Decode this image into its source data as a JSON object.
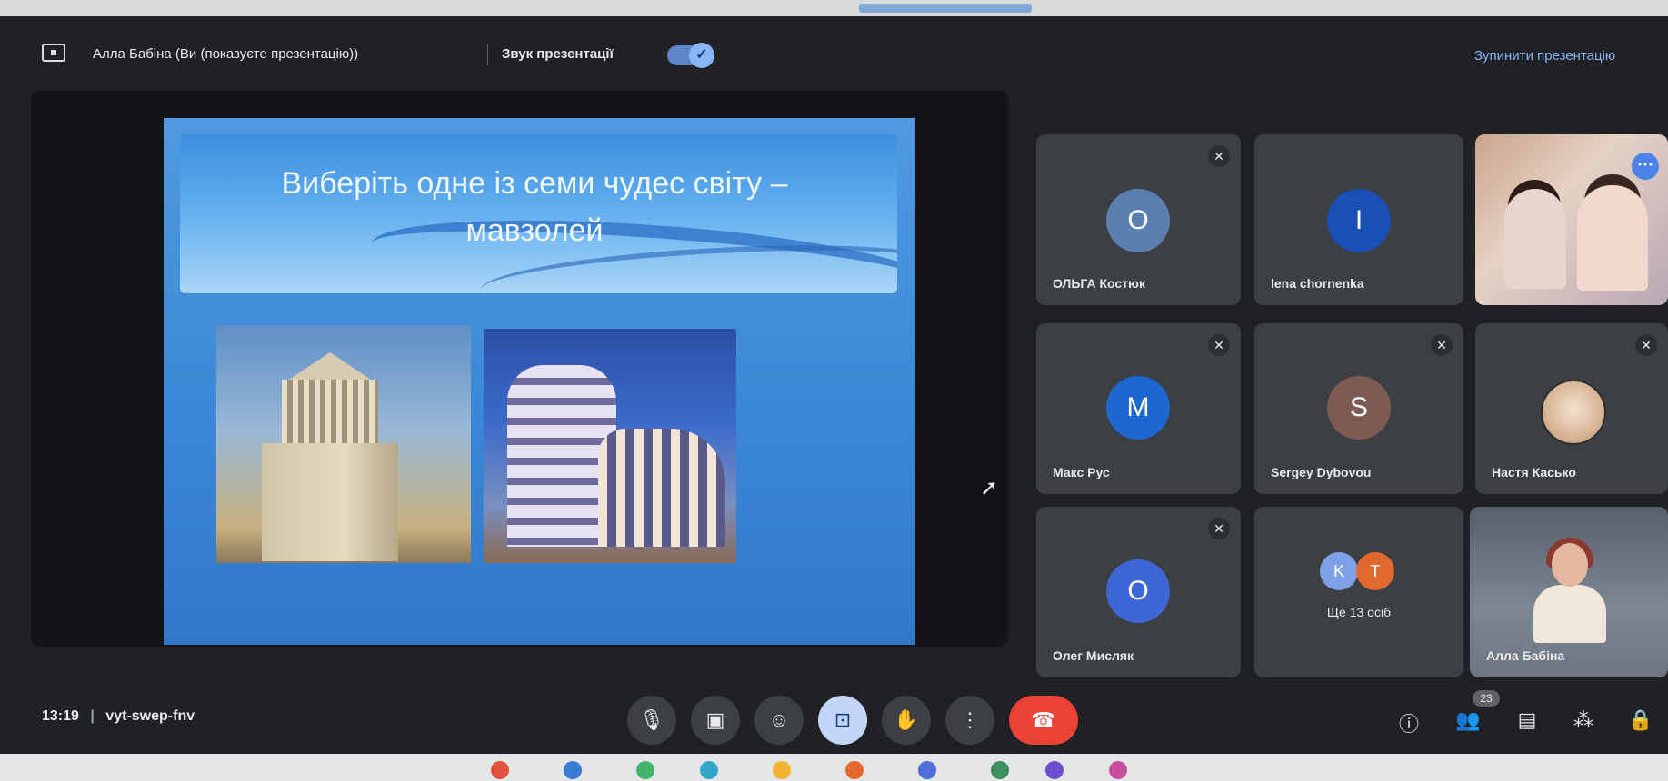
{
  "topbar": {
    "presenter_text": "Алла Бабіна (Ви (показуєте презентацію))",
    "sound_label": "Звук презентації",
    "toggle_check": "✓",
    "stop_label": "Зупинити презентацію"
  },
  "slide": {
    "title": "Виберіть одне із семи чудес світу – мавзолей"
  },
  "participants": [
    {
      "name": "ОЛЬГА Костюк",
      "initial": "О",
      "color": "#5b7fb0"
    },
    {
      "name": "lena chornenka",
      "initial": "I",
      "color": "#1a4fb5"
    },
    {
      "name": "Макс Рус",
      "initial": "M",
      "color": "#1e66d0"
    },
    {
      "name": "Sergey Dybovou",
      "initial": "S",
      "color": "#7d5b52"
    },
    {
      "name": "Настя Касько",
      "initial": "",
      "color": "#d7b79c"
    },
    {
      "name": "Олег Мисляк",
      "initial": "O",
      "color": "#3e67d6"
    },
    {
      "name": "Алла Бабіна",
      "initial": "",
      "color": ""
    }
  ],
  "more_tile": {
    "label": "Ще 13 осіб",
    "avatars": [
      {
        "initial": "K",
        "color": "#7ea0e6"
      },
      {
        "initial": "T",
        "color": "#e2682e"
      }
    ]
  },
  "bottombar": {
    "time": "13:19",
    "separator": "|",
    "meeting_code": "vyt-swep-fnv",
    "participants_count": "23"
  },
  "icons": {
    "mic": "🎙",
    "mic_off": "✕",
    "camera": "▣",
    "emoji": "☺",
    "present": "⊡",
    "hand": "✋",
    "more": "⋮",
    "end_call": "☎",
    "info": "ⓘ",
    "people": "👥",
    "chat": "▤",
    "activities": "⁂",
    "lock": "🔒",
    "tile_more": "⋯"
  }
}
